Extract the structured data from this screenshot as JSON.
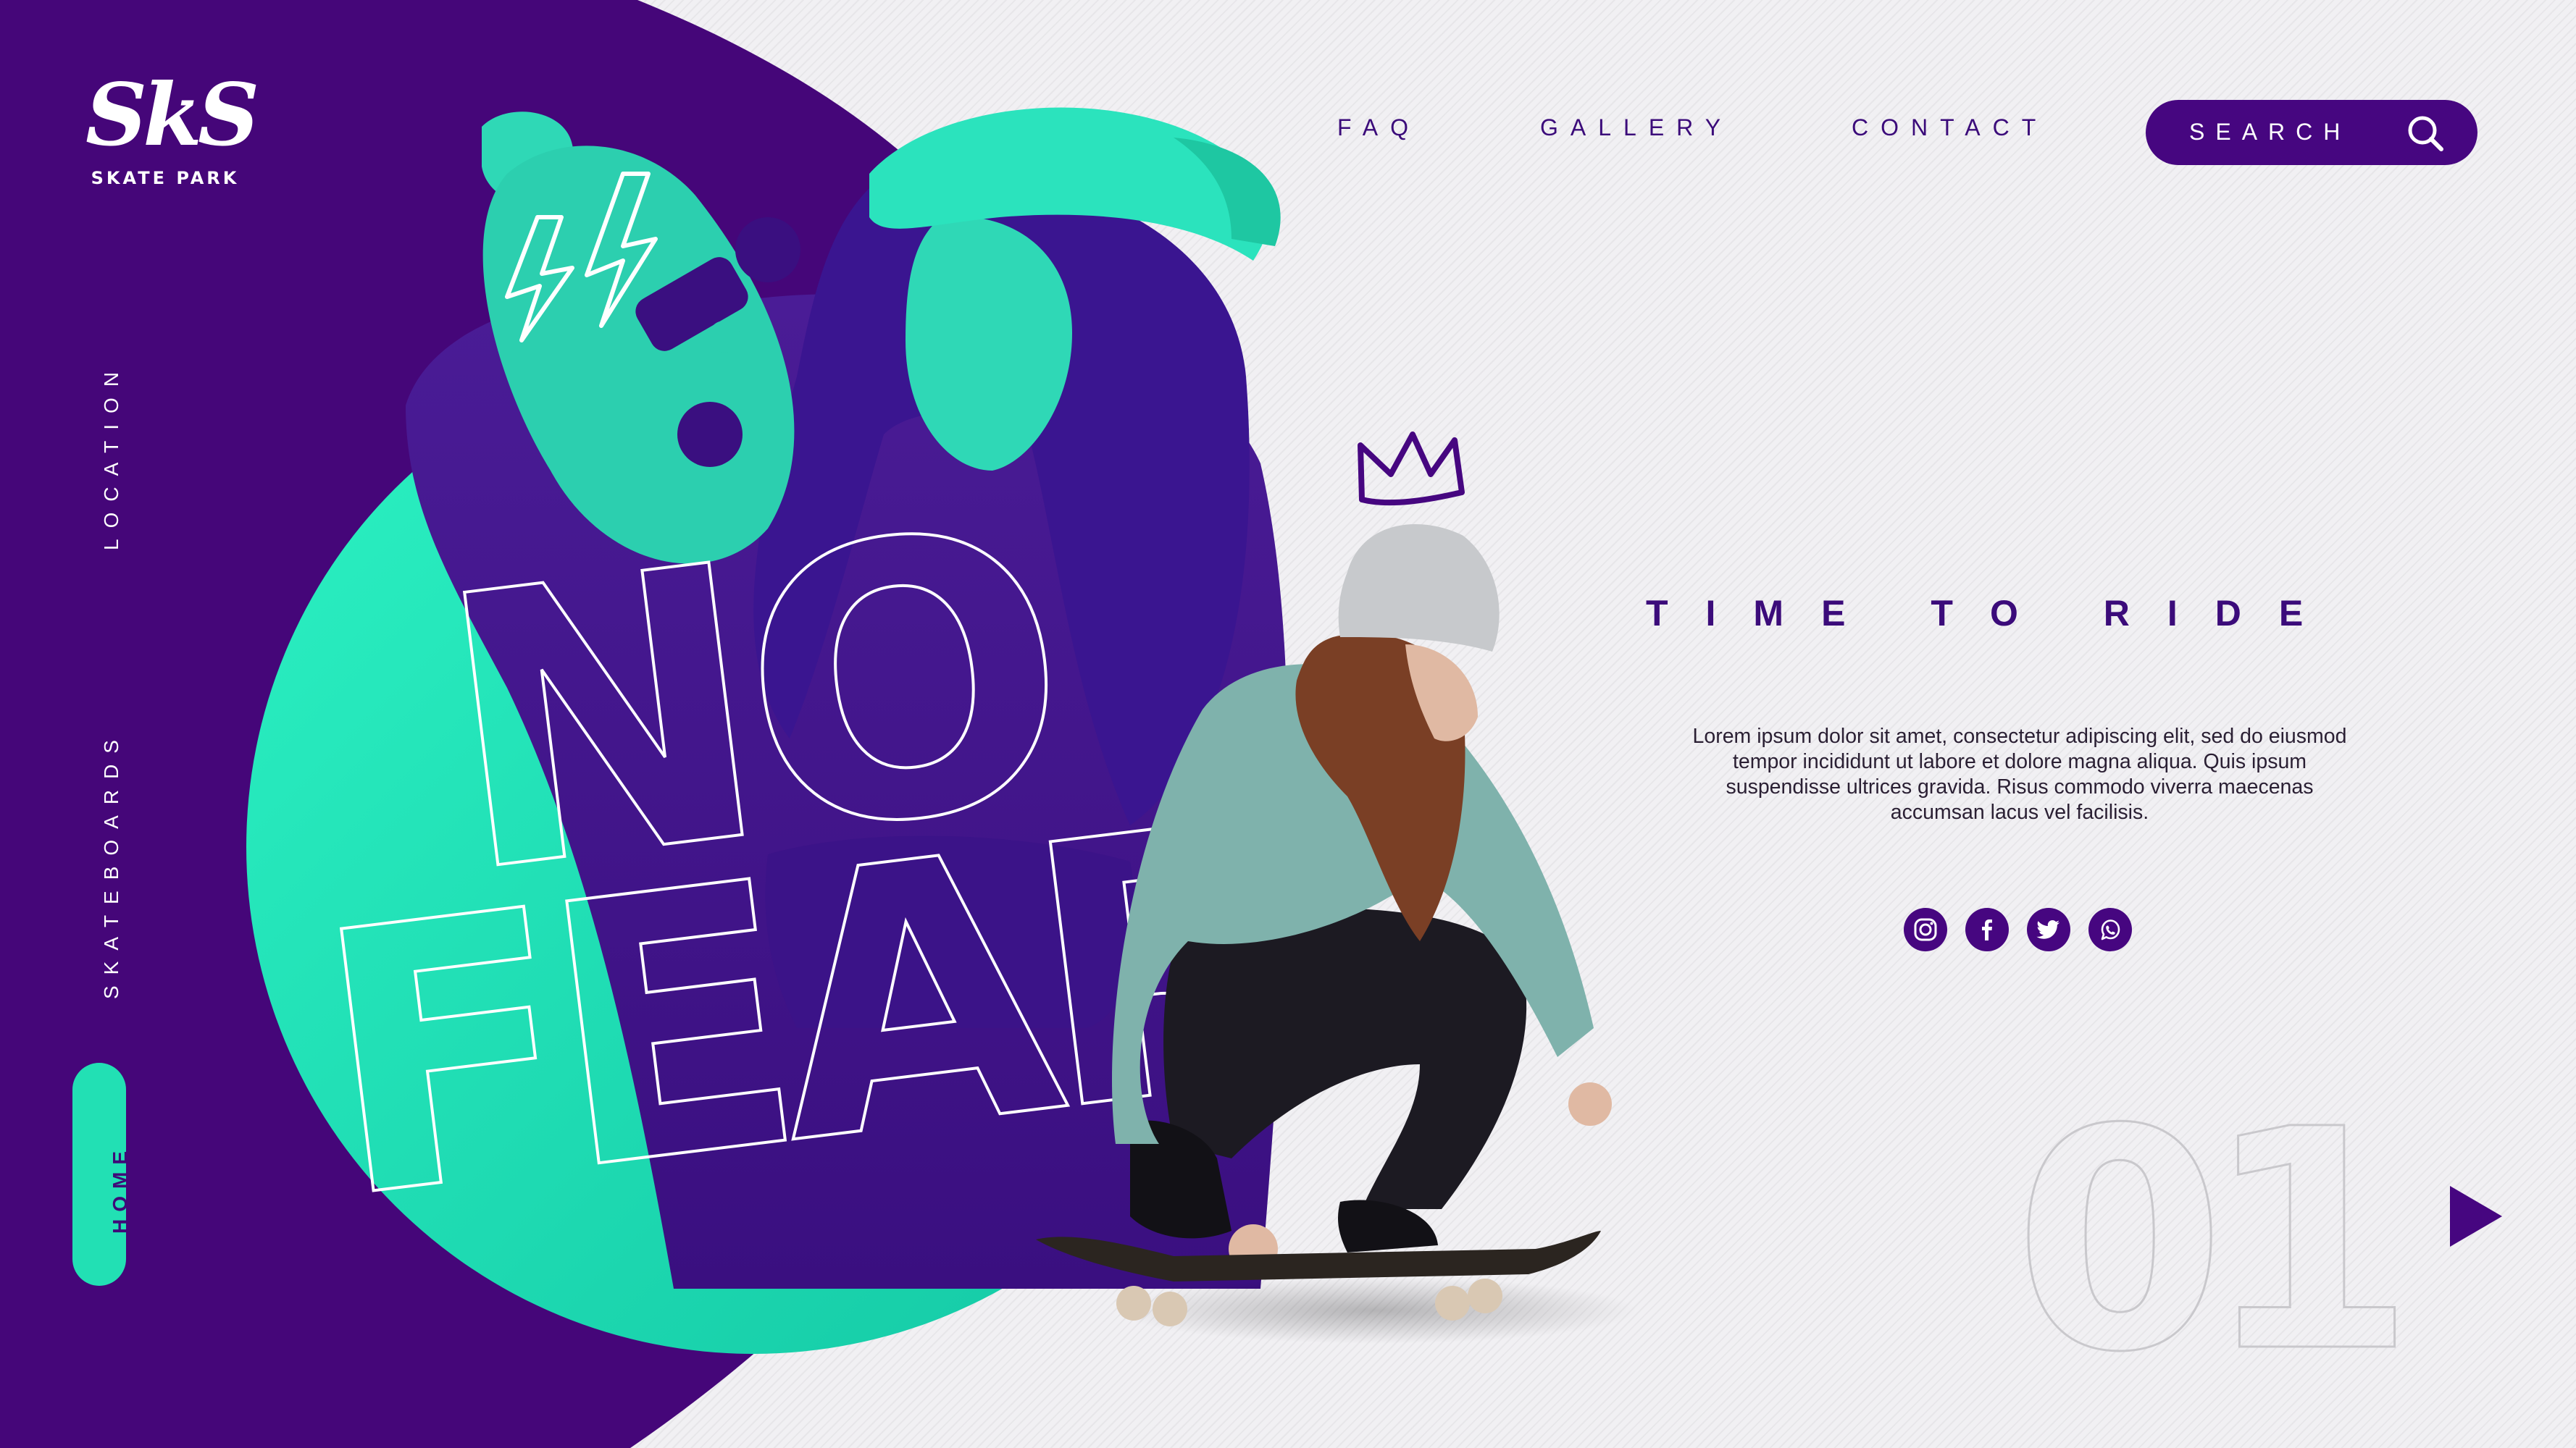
{
  "logo": {
    "mark": "SkS",
    "subtitle": "SKATE PARK"
  },
  "side_nav": {
    "items": [
      {
        "label": "LOCATION"
      },
      {
        "label": "SKATEBOARDS"
      }
    ],
    "active": {
      "label": "HOME"
    }
  },
  "top_nav": {
    "items": [
      {
        "label": "FAQ"
      },
      {
        "label": "GALLERY"
      },
      {
        "label": "CONTACT"
      }
    ],
    "search_label": "SEARCH"
  },
  "hero": {
    "headline_line1": "NO",
    "headline_line2": "FEAR"
  },
  "content": {
    "tagline": "TIME TO RIDE",
    "body": "Lorem ipsum dolor sit amet, consectetur adipiscing elit, sed do eiusmod tempor incididunt ut labore et dolore magna aliqua. Quis ipsum suspendisse ultrices gravida. Risus commodo viverra maecenas accumsan lacus vel facilisis."
  },
  "socials": [
    {
      "icon": "instagram-icon"
    },
    {
      "icon": "facebook-icon"
    },
    {
      "icon": "twitter-icon"
    },
    {
      "icon": "whatsapp-icon"
    }
  ],
  "slide_number": "01",
  "colors": {
    "purple": "#460680",
    "teal": "#22e0b4",
    "background": "#f1f0f3"
  }
}
